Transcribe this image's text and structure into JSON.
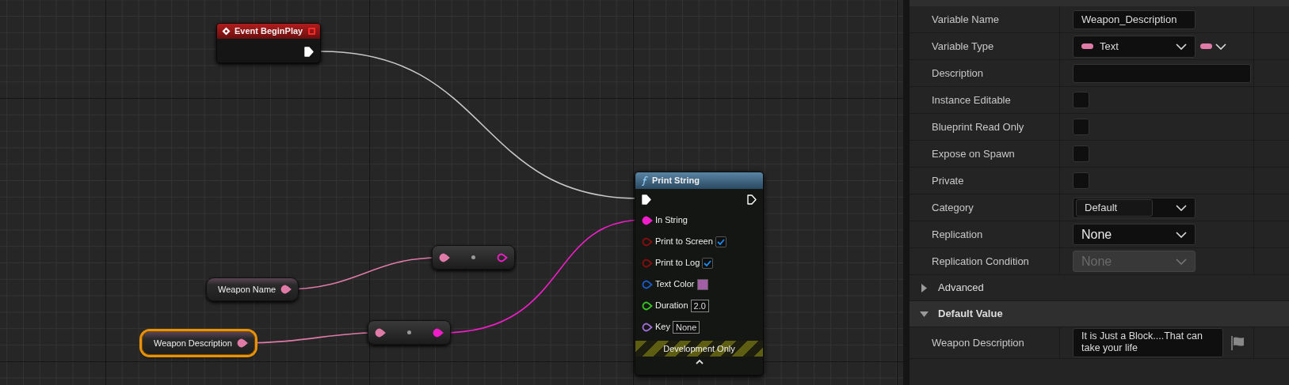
{
  "graph": {
    "event_node": {
      "title": "Event BeginPlay"
    },
    "variable_nodes": [
      {
        "label": "Weapon Name",
        "selected": false
      },
      {
        "label": "Weapon Description",
        "selected": true
      }
    ],
    "print_node": {
      "title": "Print String",
      "pins": [
        {
          "kind": "text",
          "label": "In String",
          "color": "#f01ec8"
        },
        {
          "kind": "checkbox",
          "label": "Print to Screen",
          "color": "#8a0d0d",
          "checked": true
        },
        {
          "kind": "checkbox",
          "label": "Print to Log",
          "color": "#8a0d0d",
          "checked": true
        },
        {
          "kind": "swatch",
          "label": "Text Color",
          "color": "#1a5cc8",
          "swatch": {
            "color": "#a35fa6"
          }
        },
        {
          "kind": "input",
          "label": "Duration",
          "color": "#38c81e",
          "value": "2.0"
        },
        {
          "kind": "input",
          "label": "Key",
          "color": "#a070d8",
          "value": "None"
        }
      ],
      "footer": "Development Only"
    }
  },
  "details": {
    "rows": [
      {
        "kind": "text_field",
        "label": "Variable Name",
        "value": "Weapon_Description"
      },
      {
        "kind": "type_select",
        "label": "Variable Type",
        "value": "Text"
      },
      {
        "kind": "text_field",
        "label": "Description"
      },
      {
        "kind": "checkbox",
        "label": "Instance Editable",
        "checked": false
      },
      {
        "kind": "checkbox",
        "label": "Blueprint Read Only",
        "checked": false
      },
      {
        "kind": "checkbox",
        "label": "Expose on Spawn",
        "checked": false
      },
      {
        "kind": "checkbox",
        "label": "Private",
        "checked": false
      },
      {
        "kind": "combo",
        "label": "Category",
        "value": "Default"
      },
      {
        "kind": "select",
        "label": "Replication",
        "value": "None",
        "disabled": false
      },
      {
        "kind": "select",
        "label": "Replication Condition",
        "value": "None",
        "disabled": true
      },
      {
        "kind": "section",
        "label": "Advanced",
        "expanded": false
      },
      {
        "kind": "section",
        "label": "Default Value",
        "expanded": true
      },
      {
        "kind": "multiline",
        "label": "Weapon Description",
        "value": "It is Just a Block....That can take your life"
      }
    ]
  }
}
